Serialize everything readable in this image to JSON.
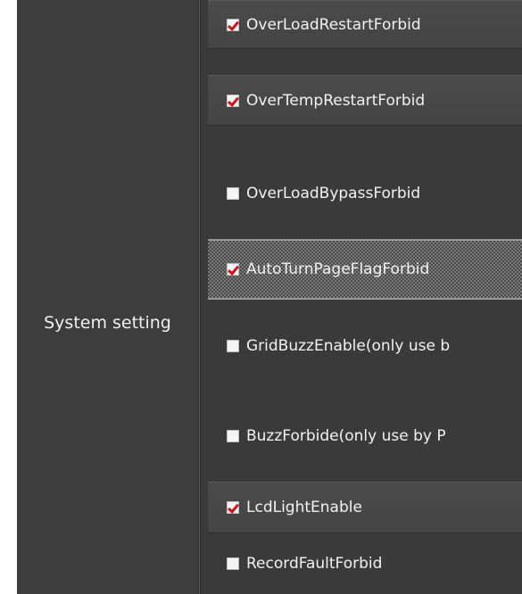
{
  "section": {
    "label": "System setting"
  },
  "settings": [
    {
      "label": "OverLoadRestartForbid",
      "checked": true
    },
    {
      "label": "OverTempRestartForbid",
      "checked": true
    },
    {
      "label": "OverLoadBypassForbid",
      "checked": false
    },
    {
      "label": "AutoTurnPageFlagForbid",
      "checked": true,
      "focused": true
    },
    {
      "label": "GridBuzzEnable(only use b",
      "checked": false
    },
    {
      "label": "BuzzForbide(only use by P",
      "checked": false
    },
    {
      "label": "LcdLightEnable",
      "checked": true
    },
    {
      "label": "RecordFaultForbid",
      "checked": false
    }
  ],
  "colors": {
    "panel": "#3a3a3a",
    "checkmark": "#c8141c",
    "text": "#f2f2f2"
  },
  "icons": {
    "checked": "checkbox-checked-icon",
    "unchecked": "checkbox-unchecked-icon"
  }
}
